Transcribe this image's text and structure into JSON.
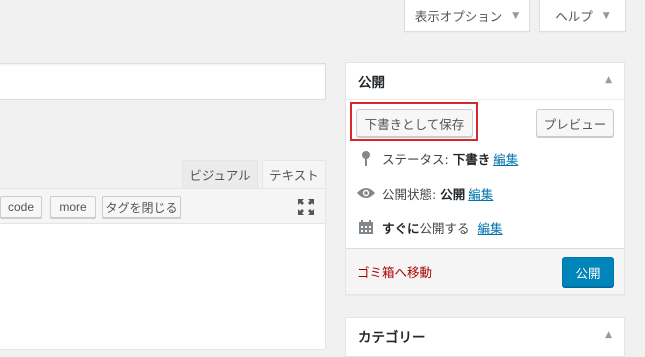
{
  "screen_meta": {
    "display_options_label": "表示オプション",
    "help_label": "ヘルプ"
  },
  "title_field": {
    "value": ""
  },
  "editor": {
    "tabs": {
      "visual": "ビジュアル",
      "text": "テキスト"
    },
    "quicktags": [
      "code",
      "more",
      "タグを閉じる"
    ]
  },
  "publish_box": {
    "title": "公開",
    "save_draft_label": "下書きとして保存",
    "preview_label": "プレビュー",
    "status_label": "ステータス:",
    "status_value": "下書き",
    "visibility_label": "公開状態:",
    "visibility_value": "公開",
    "schedule_strong": "すぐに",
    "schedule_label": "公開する",
    "edit_label": "編集",
    "trash_label": "ゴミ箱へ移動",
    "publish_label": "公開"
  },
  "category_box": {
    "title": "カテゴリー"
  },
  "colors": {
    "background": "#f1f1f1",
    "primary_button": "#0085ba",
    "link": "#0073aa",
    "delete_link": "#aa0000",
    "highlight_border": "#d62a2a"
  }
}
